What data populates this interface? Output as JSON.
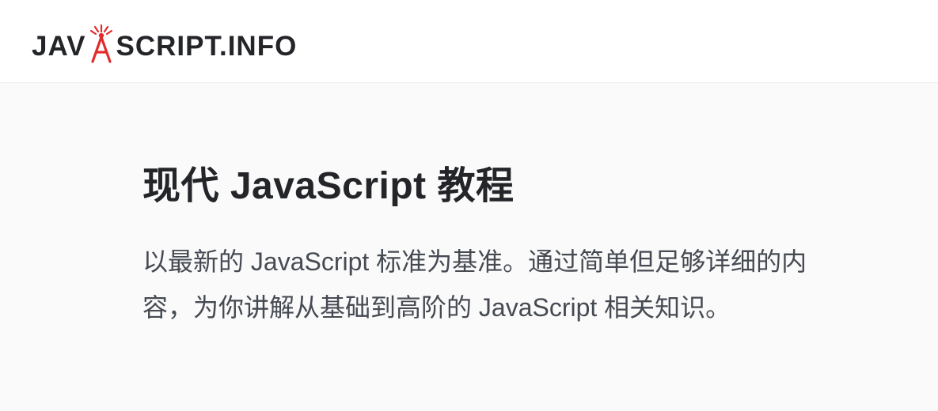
{
  "header": {
    "logo_prefix": "JAV",
    "logo_suffix": "SCRIPT.INFO"
  },
  "content": {
    "title": "现代 JavaScript 教程",
    "description": "以最新的 JavaScript 标准为基准。通过简单但足够详细的内容，为你讲解从基础到高阶的 JavaScript 相关知识。"
  }
}
